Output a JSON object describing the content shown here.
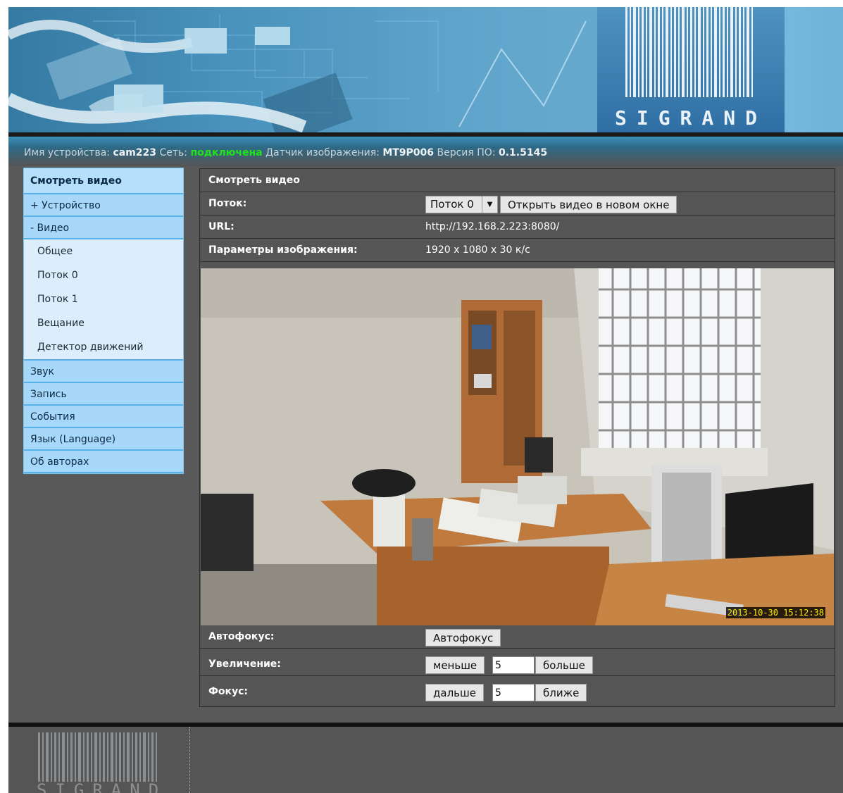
{
  "brand": {
    "logo_text": "SIGRAND"
  },
  "status": {
    "device_label": "Имя устройства:",
    "device_name": "cam223",
    "network_label": "Сеть:",
    "network_value": "подключена",
    "sensor_label": "Датчик изображения:",
    "sensor_value": "MT9P006",
    "version_label": "Версия ПО:",
    "version_value": "0.1.5145",
    "network_color": "#21e21b"
  },
  "sidebar": {
    "items": [
      {
        "label": "Смотреть видео"
      },
      {
        "label": "+ Устройство"
      },
      {
        "label": "- Видео"
      },
      {
        "label": "Звук"
      },
      {
        "label": "Запись"
      },
      {
        "label": "События"
      },
      {
        "label": "Язык (Language)"
      },
      {
        "label": "Об авторах"
      }
    ],
    "video_subitems": [
      {
        "label": "Общее"
      },
      {
        "label": "Поток 0"
      },
      {
        "label": "Поток 1"
      },
      {
        "label": "Вещание"
      },
      {
        "label": "Детектор движений"
      }
    ]
  },
  "main": {
    "title": "Смотреть видео",
    "stream_label": "Поток:",
    "stream_selected": "Поток 0",
    "open_new_window_label": "Открыть видео в новом окне",
    "url_label": "URL:",
    "url_value": "http://192.168.2.223:8080/",
    "image_params_label": "Параметры изображения:",
    "image_params_value": "1920 x 1080 x 30 к/с",
    "video_timestamp": "2013-10-30 15:12:38",
    "autofocus_label": "Автофокус:",
    "autofocus_button": "Автофокус",
    "zoom_label": "Увеличение:",
    "zoom_less": "меньше",
    "zoom_value": "5",
    "zoom_more": "больше",
    "focus_label": "Фокус:",
    "focus_far": "дальше",
    "focus_value": "5",
    "focus_near": "ближе"
  }
}
